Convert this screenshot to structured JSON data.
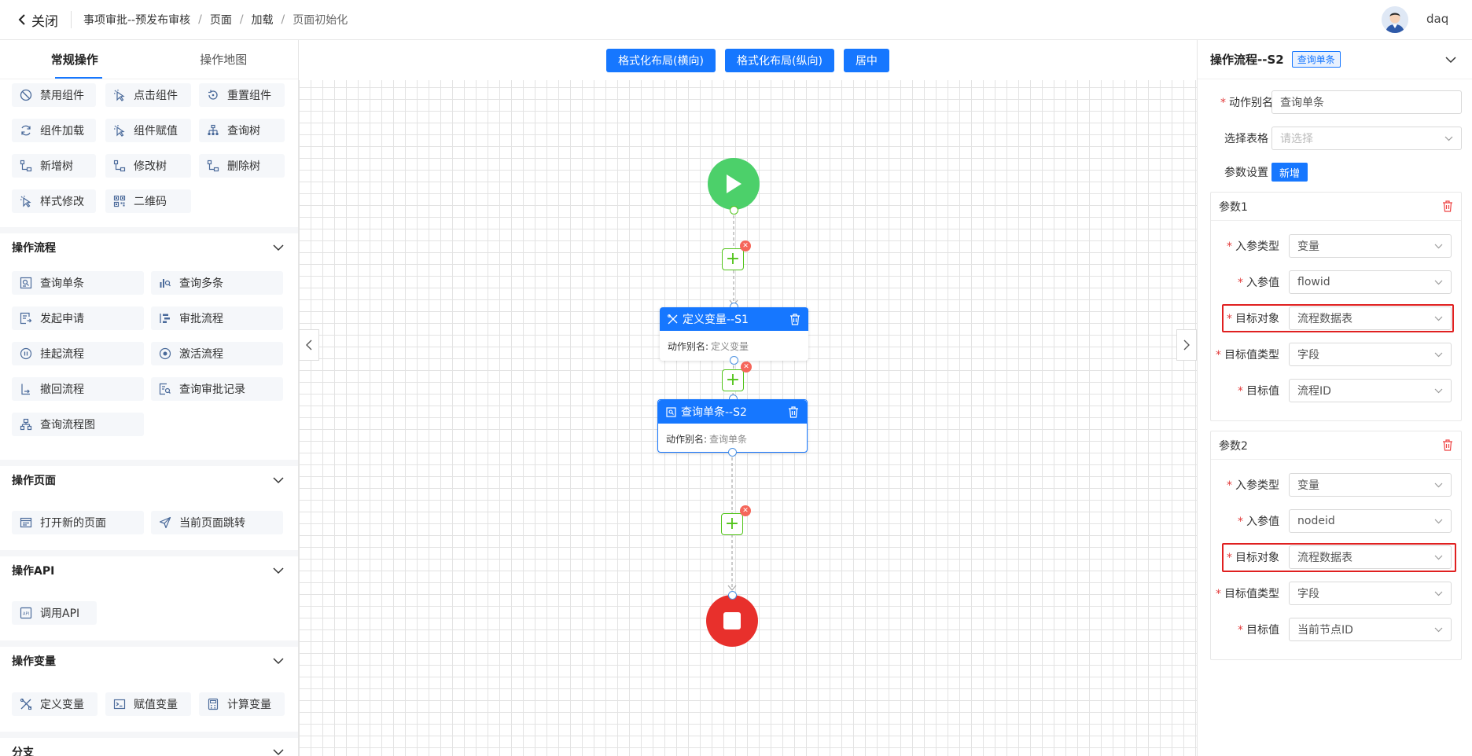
{
  "header": {
    "close_label": "关闭",
    "breadcrumb": [
      "事项审批--预发布审核",
      "页面",
      "加载",
      "页面初始化"
    ],
    "user": "daq"
  },
  "left_panel": {
    "tabs": [
      "常规操作",
      "操作地图"
    ],
    "common_ops": [
      "禁用组件",
      "点击组件",
      "重置组件",
      "组件加载",
      "组件赋值",
      "查询树",
      "新增树",
      "修改树",
      "删除树",
      "样式修改",
      "二维码"
    ],
    "sections": {
      "flow": {
        "title": "操作流程",
        "items": [
          "查询单条",
          "查询多条",
          "发起申请",
          "审批流程",
          "挂起流程",
          "激活流程",
          "撤回流程",
          "查询审批记录",
          "查询流程图"
        ]
      },
      "page": {
        "title": "操作页面",
        "items": [
          "打开新的页面",
          "当前页面跳转"
        ]
      },
      "api": {
        "title": "操作API",
        "items": [
          "调用API"
        ]
      },
      "variable": {
        "title": "操作变量",
        "items": [
          "定义变量",
          "赋值变量",
          "计算变量"
        ]
      },
      "branch": {
        "title": "分支"
      }
    }
  },
  "canvas": {
    "toolbar": [
      "格式化布局(横向)",
      "格式化布局(纵向)",
      "居中"
    ],
    "nodes": [
      {
        "title": "定义变量--S1",
        "alias_label": "动作别名:",
        "alias_value": "定义变量"
      },
      {
        "title": "查询单条--S2",
        "alias_label": "动作别名:",
        "alias_value": "查询单条"
      }
    ],
    "colors": {
      "start": "#4cd06a",
      "end": "#e8302c",
      "primary": "#1677ff"
    }
  },
  "right_panel": {
    "title": "操作流程--S2",
    "tag": "查询单条",
    "alias_label": "动作别名",
    "alias_value": "查询单条",
    "table_label": "选择表格",
    "table_placeholder": "请选择",
    "params_label": "参数设置",
    "add_label": "新增",
    "params": [
      {
        "title": "参数1",
        "fields": [
          {
            "label": "入参类型",
            "value": "变量"
          },
          {
            "label": "入参值",
            "value": "flowid"
          },
          {
            "label": "目标对象",
            "value": "流程数据表"
          },
          {
            "label": "目标值类型",
            "value": "字段"
          },
          {
            "label": "目标值",
            "value": "流程ID"
          }
        ]
      },
      {
        "title": "参数2",
        "fields": [
          {
            "label": "入参类型",
            "value": "变量"
          },
          {
            "label": "入参值",
            "value": "nodeid"
          },
          {
            "label": "目标对象",
            "value": "流程数据表"
          },
          {
            "label": "目标值类型",
            "value": "字段"
          },
          {
            "label": "目标值",
            "value": "当前节点ID"
          }
        ]
      }
    ]
  }
}
